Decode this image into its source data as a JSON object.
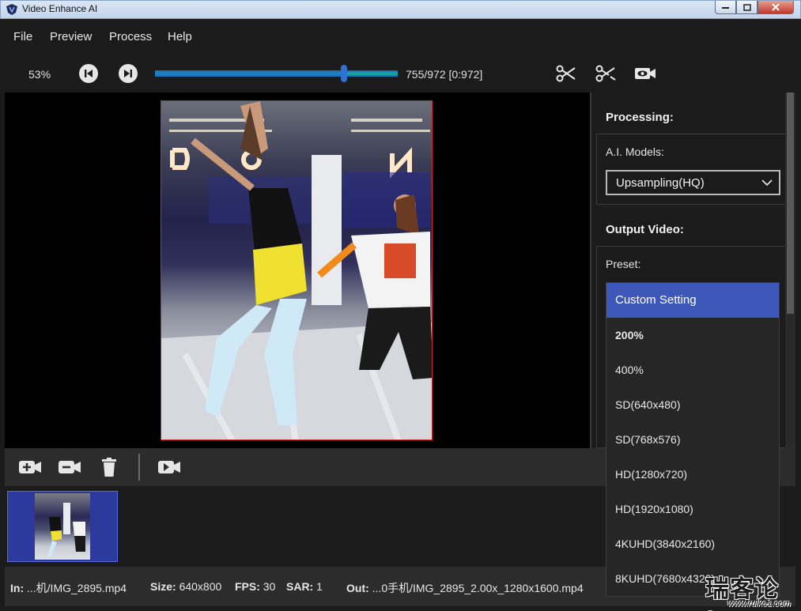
{
  "window": {
    "title": "Video Enhance AI"
  },
  "menu": {
    "items": [
      "File",
      "Preview",
      "Process",
      "Help"
    ]
  },
  "transport": {
    "zoom": "53%",
    "frame_count": "755/972  [0:972]",
    "progress_fraction": 0.777
  },
  "panel": {
    "processing_heading": "Processing:",
    "ai_models_label": "A.I. Models:",
    "ai_model_value": "Upsampling(HQ)",
    "output_heading": "Output Video:",
    "preset_label": "Preset:"
  },
  "preset_options": [
    "Custom Setting",
    "200%",
    "400%",
    "SD(640x480)",
    "SD(768x576)",
    "HD(1280x720)",
    "HD(1920x1080)",
    "4KUHD(3840x2160)",
    "8KUHD(7680x4320)"
  ],
  "preset_selected_index": 0,
  "status": {
    "in_label": "In:",
    "in_value": "...机/IMG_2895.mp4",
    "size_label": "Size:",
    "size_value": "640x800",
    "fps_label": "FPS:",
    "fps_value": "30",
    "sar_label": "SAR:",
    "sar_value": "1",
    "out_label": "Out:",
    "out_value": "...0手机/IMG_2895_2.00x_1280x1600.mp4"
  },
  "watermark": {
    "text": "瑞客论坛",
    "url": "www.ruike1.com"
  },
  "colors": {
    "accent": "#3d58b8",
    "slider": "#14a39a",
    "frame_border": "#d12727"
  }
}
